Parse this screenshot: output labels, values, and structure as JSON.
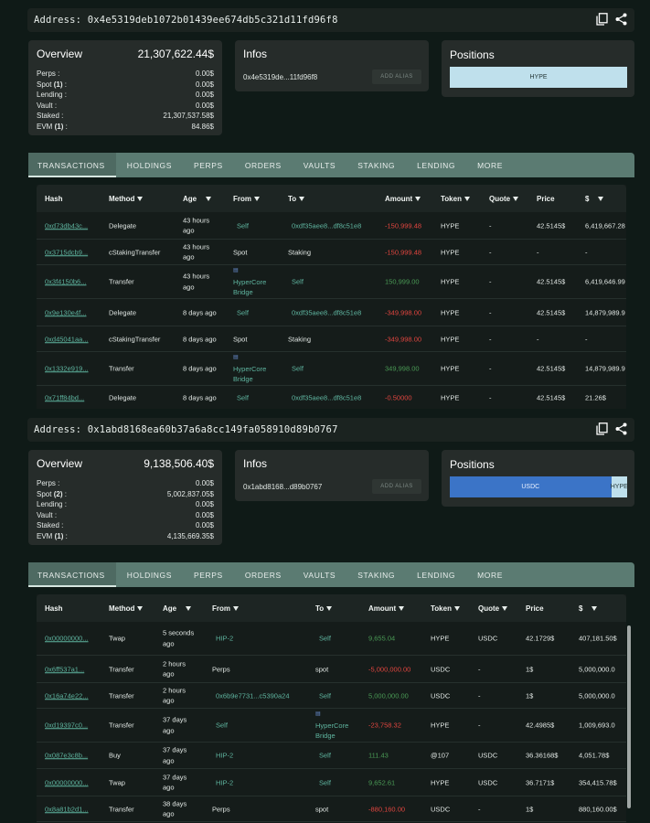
{
  "wallets": [
    {
      "address_line": "Address: 0x4e5319deb1072b01439ee674db5c321d11fd96f8",
      "overview": {
        "title": "Overview",
        "total": "21,307,622.44$",
        "rows": [
          {
            "label": "Perps :",
            "count": "",
            "value": "0.00$"
          },
          {
            "label": "Spot",
            "count": "(1)",
            "value": "0.00$"
          },
          {
            "label": "Lending :",
            "count": "",
            "value": "0.00$"
          },
          {
            "label": "Vault :",
            "count": "",
            "value": "0.00$"
          },
          {
            "label": "Staked :",
            "count": "",
            "value": "21,307,537.58$"
          },
          {
            "label": "EVM",
            "count": "(1)",
            "value": "84.86$"
          }
        ]
      },
      "infos": {
        "title": "Infos",
        "short_address": "0x4e5319de...11fd96f8",
        "alias_label": "ADD ALIAS"
      },
      "positions": {
        "title": "Positions",
        "segments": [
          {
            "label": "HYPE",
            "share": 1.0,
            "color": "#bfe0ec"
          }
        ]
      },
      "tabs": [
        "TRANSACTIONS",
        "HOLDINGS",
        "PERPS",
        "ORDERS",
        "VAULTS",
        "STAKING",
        "LENDING",
        "MORE"
      ],
      "columns": [
        "Hash",
        "Method",
        "Age",
        "From",
        "To",
        "Amount",
        "Token",
        "Quote",
        "Price",
        "$"
      ],
      "rows": [
        {
          "hash": "0xd73db43c...",
          "method": "Delegate",
          "age": "43 hours ago",
          "from": "Self",
          "to": "0xdf35aee8...df8c51e8",
          "amount": "-150,999.48",
          "token": "HYPE",
          "quote": "-",
          "price": "42.5145$",
          "usd": "6,419,667.28"
        },
        {
          "hash": "0x3715dcb9...",
          "method": "cStakingTransfer",
          "age": "43 hours ago",
          "from": "Spot",
          "to": "Staking",
          "amount": "-150,999.48",
          "token": "HYPE",
          "quote": "-",
          "price": "-",
          "usd": "-"
        },
        {
          "hash": "0x3f4150b6...",
          "method": "Transfer",
          "age": "43 hours ago",
          "from": "HyperCore Bridge",
          "to": "Self",
          "amount": "150,999.00",
          "token": "HYPE",
          "quote": "-",
          "price": "42.5145$",
          "usd": "6,419,646.99"
        },
        {
          "hash": "0x9e130e4f...",
          "method": "Delegate",
          "age": "8 days ago",
          "from": "Self",
          "to": "0xdf35aee8...df8c51e8",
          "amount": "-349,998.00",
          "token": "HYPE",
          "quote": "-",
          "price": "42.5145$",
          "usd": "14,879,989.9"
        },
        {
          "hash": "0xd45041aa...",
          "method": "cStakingTransfer",
          "age": "8 days ago",
          "from": "Spot",
          "to": "Staking",
          "amount": "-349,998.00",
          "token": "HYPE",
          "quote": "-",
          "price": "-",
          "usd": "-"
        },
        {
          "hash": "0x1332e919...",
          "method": "Transfer",
          "age": "8 days ago",
          "from": "HyperCore Bridge",
          "to": "Self",
          "amount": "349,998.00",
          "token": "HYPE",
          "quote": "-",
          "price": "42.5145$",
          "usd": "14,879,989.9"
        },
        {
          "hash": "0x71ff84bd...",
          "method": "Delegate",
          "age": "8 days ago",
          "from": "Self",
          "to": "0xdf35aee8...df8c51e8",
          "amount": "-0.50000",
          "token": "HYPE",
          "quote": "-",
          "price": "42.5145$",
          "usd": "21.26$"
        }
      ]
    },
    {
      "address_line": "Address: 0x1abd8168ea60b37a6a8cc149fa058910d89b0767",
      "overview": {
        "title": "Overview",
        "total": "9,138,506.40$",
        "rows": [
          {
            "label": "Perps :",
            "count": "",
            "value": "0.00$"
          },
          {
            "label": "Spot",
            "count": "(2)",
            "value": "5,002,837.05$"
          },
          {
            "label": "Lending :",
            "count": "",
            "value": "0.00$"
          },
          {
            "label": "Vault :",
            "count": "",
            "value": "0.00$"
          },
          {
            "label": "Staked :",
            "count": "",
            "value": "0.00$"
          },
          {
            "label": "EVM",
            "count": "(1)",
            "value": "4,135,669.35$"
          }
        ]
      },
      "infos": {
        "title": "Infos",
        "short_address": "0x1abd8168...d89b0767",
        "alias_label": "ADD ALIAS"
      },
      "positions": {
        "title": "Positions",
        "segments": [
          {
            "label": "USDC",
            "share": 0.91,
            "color": "#3b74c7"
          },
          {
            "label": "HYPE",
            "share": 0.09,
            "color": "#bfe0ec"
          }
        ]
      },
      "tabs": [
        "TRANSACTIONS",
        "HOLDINGS",
        "PERPS",
        "ORDERS",
        "VAULTS",
        "STAKING",
        "LENDING",
        "MORE"
      ],
      "columns": [
        "Hash",
        "Method",
        "Age",
        "From",
        "To",
        "Amount",
        "Token",
        "Quote",
        "Price",
        "$"
      ],
      "rows": [
        {
          "hash": "0x00000000...",
          "method": "Twap",
          "age": "5 seconds ago",
          "from": "HIP-2",
          "to": "Self",
          "amount": "9,655.04",
          "token": "HYPE",
          "quote": "USDC",
          "price": "42.1729$",
          "usd": "407,181.50$"
        },
        {
          "hash": "0x6ff537a1...",
          "method": "Transfer",
          "age": "2 hours ago",
          "from": "Perps",
          "to": "spot",
          "amount": "-5,000,000.00",
          "token": "USDC",
          "quote": "-",
          "price": "1$",
          "usd": "5,000,000.0"
        },
        {
          "hash": "0x16a74e22...",
          "method": "Transfer",
          "age": "2 hours ago",
          "from": "0x6b9e7731...c5390a24",
          "to": "Self",
          "amount": "5,000,000.00",
          "token": "USDC",
          "quote": "-",
          "price": "1$",
          "usd": "5,000,000.0"
        },
        {
          "hash": "0xd19397c0...",
          "method": "Transfer",
          "age": "37 days ago",
          "from": "Self",
          "to": "HyperCore Bridge",
          "amount": "-23,758.32",
          "token": "HYPE",
          "quote": "-",
          "price": "42.4985$",
          "usd": "1,009,693.0"
        },
        {
          "hash": "0x087e3c8b...",
          "method": "Buy",
          "age": "37 days ago",
          "from": "HIP-2",
          "to": "Self",
          "amount": "111.43",
          "token": "@107",
          "quote": "USDC",
          "price": "36.36168$",
          "usd": "4,051.78$"
        },
        {
          "hash": "0x00000000...",
          "method": "Twap",
          "age": "37 days ago",
          "from": "HIP-2",
          "to": "Self",
          "amount": "9,652.61",
          "token": "HYPE",
          "quote": "USDC",
          "price": "36.7171$",
          "usd": "354,415.78$"
        },
        {
          "hash": "0x8a81b2d1...",
          "method": "Transfer",
          "age": "38 days ago",
          "from": "Perps",
          "to": "spot",
          "amount": "-880,160.00",
          "token": "USDC",
          "quote": "-",
          "price": "1$",
          "usd": "880,160.00$"
        }
      ]
    }
  ]
}
